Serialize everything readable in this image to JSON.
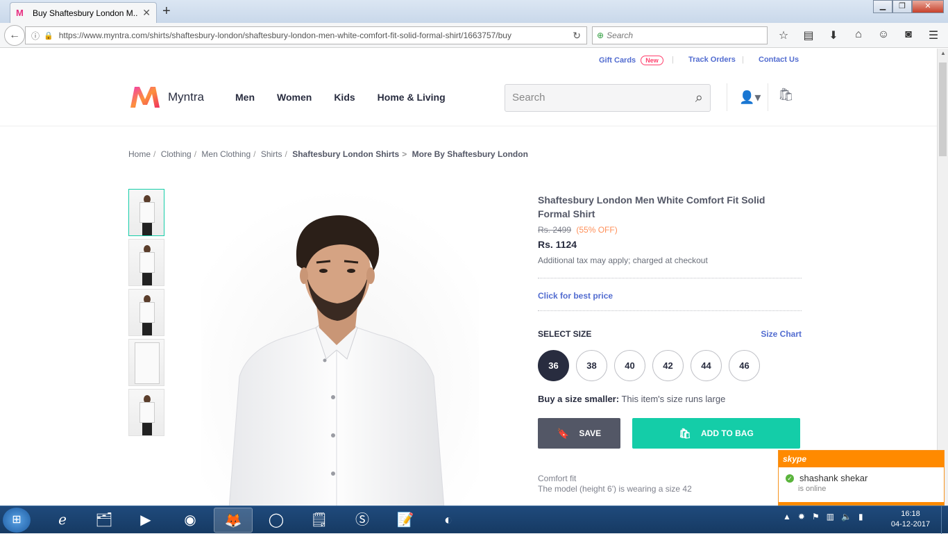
{
  "browser": {
    "tab_title": "Buy Shaftesbury London M...",
    "tab_close": "✕",
    "new_tab": "+",
    "url": "https://www.myntra.com/shirts/shaftesbury-london/shaftesbury-london-men-white-comfort-fit-solid-formal-shirt/1663757/buy",
    "search_placeholder": "Search"
  },
  "toplinks": {
    "gift_cards": "Gift Cards",
    "new_badge": "New",
    "track_orders": "Track Orders",
    "contact_us": "Contact Us"
  },
  "header": {
    "brand": "Myntra",
    "menu": [
      "Men",
      "Women",
      "Kids",
      "Home & Living"
    ],
    "search_placeholder": "Search"
  },
  "breadcrumb": {
    "items": [
      "Home",
      "Clothing",
      "Men Clothing",
      "Shirts"
    ],
    "current": "Shaftesbury London Shirts",
    "more": "More By Shaftesbury London",
    "separator": "/",
    "arrow": ">"
  },
  "product": {
    "title": "Shaftesbury London Men White Comfort Fit Solid Formal Shirt",
    "mrp": "Rs. 2499",
    "discount": "(55% OFF)",
    "price": "Rs. 1124",
    "tax_note": "Additional tax may apply; charged at checkout",
    "best_price": "Click for best price",
    "select_size": "SELECT SIZE",
    "size_chart": "Size Chart",
    "sizes": [
      "36",
      "38",
      "40",
      "42",
      "44",
      "46"
    ],
    "selected_size": "36",
    "size_hint_bold": "Buy a size smaller:",
    "size_hint": " This item's size runs large",
    "save_label": "SAVE",
    "add_to_bag_label": "ADD TO BAG",
    "fit": "Comfort fit",
    "model_note": "The model (height 6') is wearing a size 42"
  },
  "skype": {
    "title": "skype",
    "contact": "shashank shekar",
    "status": "is online"
  },
  "taskbar": {
    "time": "16:18",
    "date": "04-12-2017"
  },
  "colors": {
    "accent": "#14cda8",
    "link": "#526cd0",
    "brand_pink": "#ff3f6c",
    "discount": "#ff905a",
    "dark": "#282c3f"
  }
}
